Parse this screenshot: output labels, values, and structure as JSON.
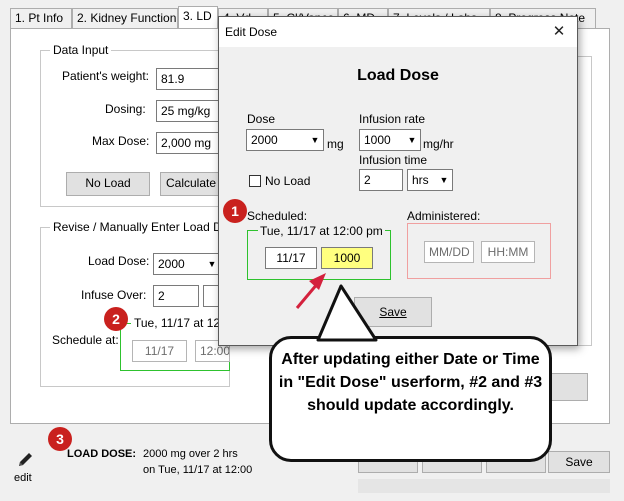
{
  "tabs": [
    {
      "label": "1. Pt Info"
    },
    {
      "label": "2. Kidney Function"
    },
    {
      "label": "3. LD"
    },
    {
      "label": "4. Vd"
    },
    {
      "label": "5. Cl/Vanco"
    },
    {
      "label": "6. MD"
    },
    {
      "label": "7. Levels / Labs"
    },
    {
      "label": "8. Progress Note"
    }
  ],
  "data_input": {
    "legend": "Data Input",
    "weight_label": "Patient's weight:",
    "weight_value": "81.9",
    "dosing_label": "Dosing:",
    "dosing_value": "25 mg/kg",
    "max_dose_label": "Max Dose:",
    "max_dose_value": "2,000 mg",
    "no_load_button": "No Load",
    "calculate_button": "Calculate"
  },
  "revise": {
    "legend": "Revise / Manually Enter Load Dose",
    "load_dose_label": "Load Dose:",
    "load_dose_value": "2000",
    "infuse_over_label": "Infuse Over:",
    "infuse_over_value": "2",
    "schedule_label": "Schedule at:",
    "schedule_text": "Tue, 11/17 at 12:00",
    "schedule_date": "11/17",
    "schedule_time": "12:00"
  },
  "bottom": {
    "load_dose_label": "LOAD DOSE:",
    "load_dose_line1": "2000 mg over 2 hrs",
    "load_dose_line2": "on Tue, 11/17 at 12:00",
    "edit_label": "edit",
    "save_button": "Save"
  },
  "dialog": {
    "title": "Edit Dose",
    "close_glyph": "✕",
    "heading": "Load Dose",
    "dose_label": "Dose",
    "dose_value": "2000",
    "dose_unit": "mg",
    "infusion_rate_label": "Infusion rate",
    "infusion_rate_value": "1000",
    "infusion_rate_unit": "mg/hr",
    "infusion_time_label": "Infusion time",
    "infusion_time_value": "2",
    "infusion_time_unit": "hrs",
    "no_load_label": "No Load",
    "scheduled_label": "Scheduled:",
    "scheduled_text": "Tue, 11/17 at 12:00 pm",
    "scheduled_date": "11/17",
    "scheduled_time": "1000",
    "administered_label": "Administered:",
    "admin_date_placeholder": "MM/DD",
    "admin_time_placeholder": "HH:MM",
    "save_button": "Save"
  },
  "badges": [
    "1",
    "2",
    "3"
  ],
  "callout_text": "After updating either Date or Time in \"Edit Dose\" userform, #2 and #3 should update accordingly.",
  "colors": {
    "badge": "#c9211e",
    "group_green": "#2ec22e",
    "highlight": "#ffff7f",
    "arrow": "#d4213d"
  }
}
